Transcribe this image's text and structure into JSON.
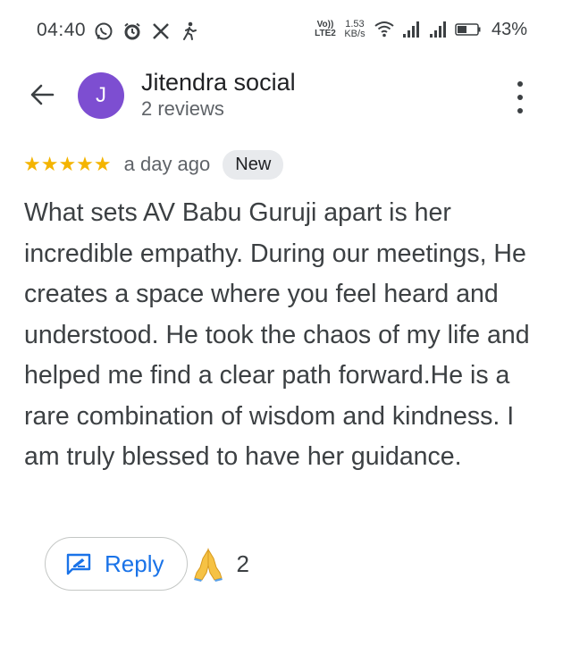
{
  "status_bar": {
    "time": "04:40",
    "volte_line1": "Vo))",
    "volte_line2": "LTE2",
    "net_speed_value": "1.53",
    "net_speed_unit": "KB/s",
    "battery": "43%",
    "icons": [
      "whatsapp-icon",
      "alarm-icon",
      "x-icon",
      "accessibility-icon",
      "wifi-icon",
      "signal-1-icon",
      "signal-2-icon",
      "battery-icon"
    ]
  },
  "header": {
    "avatar_letter": "J",
    "avatar_color": "#7d4ed1",
    "reviewer_name": "Jitendra social",
    "review_count": "2 reviews"
  },
  "review": {
    "stars": "★★★★★",
    "rating": 5,
    "time_ago": "a day ago",
    "badge": "New",
    "text": "What sets AV Babu Guruji apart is her incredible empathy. During our meetings, He creates a space where you feel heard and understood. He took the chaos of my life and helped me find a clear path forward.He is a rare combination of wisdom and kindness. I am truly blessed to have her guidance."
  },
  "actions": {
    "reply_label": "Reply",
    "reaction_icon": "folded-hands-icon",
    "reaction_count": "2"
  },
  "colors": {
    "star": "#f4b400",
    "accent": "#1a73e8",
    "text": "#3c4043"
  }
}
